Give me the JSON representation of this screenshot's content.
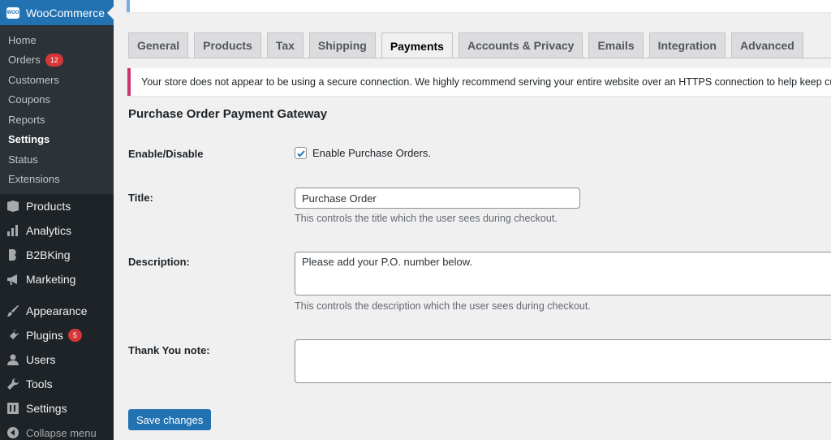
{
  "sidebar": {
    "current": {
      "label": "WooCommerce",
      "logo_text": "WOO"
    },
    "submenu": [
      {
        "label": "Home"
      },
      {
        "label": "Orders",
        "badge": "12"
      },
      {
        "label": "Customers"
      },
      {
        "label": "Coupons"
      },
      {
        "label": "Reports"
      },
      {
        "label": "Settings",
        "active": true
      },
      {
        "label": "Status"
      },
      {
        "label": "Extensions"
      }
    ],
    "group1": [
      {
        "label": "Products",
        "icon": "archive-icon"
      },
      {
        "label": "Analytics",
        "icon": "bar-chart-icon"
      },
      {
        "label": "B2BKing",
        "icon": "b2bking-icon"
      },
      {
        "label": "Marketing",
        "icon": "megaphone-icon"
      }
    ],
    "group2": [
      {
        "label": "Appearance",
        "icon": "paintbrush-icon"
      },
      {
        "label": "Plugins",
        "icon": "plugin-icon",
        "badge": "5"
      },
      {
        "label": "Users",
        "icon": "users-icon"
      },
      {
        "label": "Tools",
        "icon": "wrench-icon"
      },
      {
        "label": "Settings",
        "icon": "settings-icon"
      }
    ],
    "collapse_label": "Collapse menu"
  },
  "tabs": [
    {
      "label": "General"
    },
    {
      "label": "Products"
    },
    {
      "label": "Tax"
    },
    {
      "label": "Shipping"
    },
    {
      "label": "Payments",
      "active": true
    },
    {
      "label": "Accounts & Privacy"
    },
    {
      "label": "Emails"
    },
    {
      "label": "Integration"
    },
    {
      "label": "Advanced"
    }
  ],
  "notice": {
    "text": "Your store does not appear to be using a secure connection. We highly recommend serving your entire website over an HTTPS connection to help keep customer data secure."
  },
  "form": {
    "heading": "Purchase Order Payment Gateway",
    "enable_label": "Enable/Disable",
    "enable_checkbox_label": "Enable Purchase Orders.",
    "enable_checked": true,
    "title_label": "Title:",
    "title_value": "Purchase Order",
    "title_desc": "This controls the title which the user sees during checkout.",
    "description_label": "Description:",
    "description_value": "Please add your P.O. number below.",
    "description_desc": "This controls the description which the user sees during checkout.",
    "thankyou_label": "Thank You note:",
    "thankyou_value": ""
  },
  "save_button": "Save changes",
  "colors": {
    "accent": "#2271b1",
    "sidebar_bg": "#1d2327",
    "notice_border": "#c9356e",
    "badge": "#d63638"
  }
}
